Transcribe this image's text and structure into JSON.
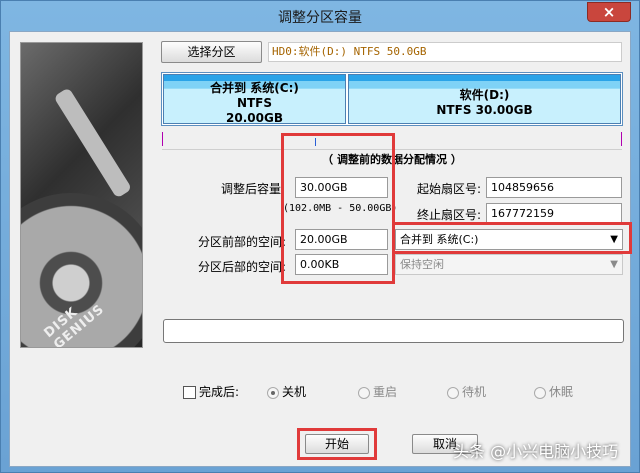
{
  "window": {
    "title": "调整分区容量",
    "close_glyph": "×"
  },
  "toolbar": {
    "select_partition_label": "选择分区"
  },
  "disk_info": "HD0:软件(D:) NTFS 50.0GB",
  "disk_image": {
    "brand_text": "DISK GENIUS"
  },
  "partitions": [
    {
      "line1": "合并到 系统(C:)",
      "line2": "NTFS",
      "line3": "20.00GB"
    },
    {
      "line1": "软件(D:)",
      "line2": "NTFS 30.00GB"
    }
  ],
  "section_caption": "（ 调整前的数据分配情况 ）",
  "fields": {
    "adjusted_size": {
      "label": "调整后容量:",
      "value": "30.00GB"
    },
    "size_range": "(102.0MB - 50.00GB)",
    "start_sector": {
      "label": "起始扇区号:",
      "value": "104859656"
    },
    "end_sector": {
      "label": "终止扇区号:",
      "value": "167772159"
    },
    "space_before": {
      "label": "分区前部的空间:",
      "value": "20.00GB",
      "action": "合并到 系统(C:)"
    },
    "space_after": {
      "label": "分区后部的空间:",
      "value": "0.00KB",
      "action": "保持空闲"
    }
  },
  "after_completion": {
    "label": "完成后:",
    "checked": false,
    "options": [
      {
        "label": "关机",
        "selected": true
      },
      {
        "label": "重启",
        "selected": false
      },
      {
        "label": "待机",
        "selected": false
      },
      {
        "label": "休眠",
        "selected": false
      }
    ]
  },
  "buttons": {
    "start": "开始",
    "cancel": "取消"
  },
  "watermark": "头条 @小兴电脑小技巧",
  "colors": {
    "highlight": "#e03a3a",
    "disk_info_text": "#a56400",
    "partition_fill": "#7fd2f6"
  }
}
